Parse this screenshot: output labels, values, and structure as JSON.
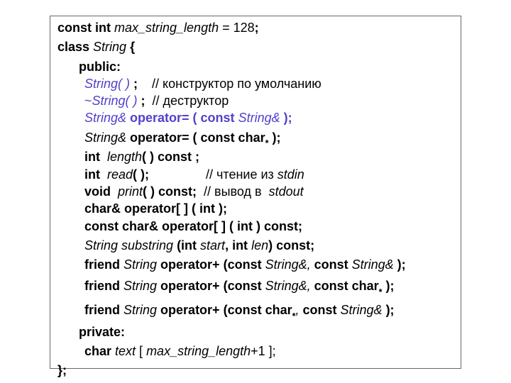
{
  "code": {
    "l1a": "const int",
    "l1b": " max_string_length ",
    "l1c": "= 128",
    "l1d": ";",
    "l2a": "class",
    "l2b": " String ",
    "l2c": "{",
    "l3": "public:",
    "l4a": "String( ) ",
    "l4b": ";",
    "l4c": "    // конструктор по умолчанию",
    "l5a": "~",
    "l5b": "String( ) ",
    "l5c": ";",
    "l5d": "  // деструктор",
    "l6a": "String& ",
    "l6b": "operator= ( const ",
    "l6c": "String& ",
    "l6d": ");",
    "l7a": "String&",
    "l7b": " operator= ( const char",
    "l7c": "*",
    "l7d": " );",
    "l8a": "int",
    "l8b": "  length",
    "l8c": "( ) const ;",
    "l9a": "int",
    "l9b": "  read",
    "l9c": "( );",
    "l9d": "                // чтение из ",
    "l9e": "stdin",
    "l10a": "void",
    "l10b": "  print",
    "l10c": "( ) const;",
    "l10d": "  // вывод в  ",
    "l10e": "stdout",
    "l11a": "char& operator[ ] ( int );",
    "l12a": "const char& operator[ ] ( int ) const;",
    "l13a": "String substring ",
    "l13b": "(int",
    "l13c": " start",
    "l13d": ", int",
    "l13e": " len",
    "l13f": ") const;",
    "l14a": "friend",
    "l14b": " String ",
    "l14c": "operator+ (const",
    "l14d": " String&, ",
    "l14e": "const",
    "l14f": " String& ",
    "l14g": ");",
    "l15a": "friend",
    "l15b": " String ",
    "l15c": "operator+ (const",
    "l15d": " String&, ",
    "l15e": "const char",
    "l15f": "*",
    "l15g": " );",
    "l16a": "friend",
    "l16b": " String ",
    "l16c": "operator+ (const char",
    "l16d": "*",
    "l16e": ", ",
    "l16f": "const",
    "l16g": " String& ",
    "l16h": ");",
    "l17": "private:",
    "l18a": "char",
    "l18b": " text ",
    "l18c": "[ ",
    "l18d": "max_string_length",
    "l18e": "+1 ];",
    "l19": "};"
  }
}
